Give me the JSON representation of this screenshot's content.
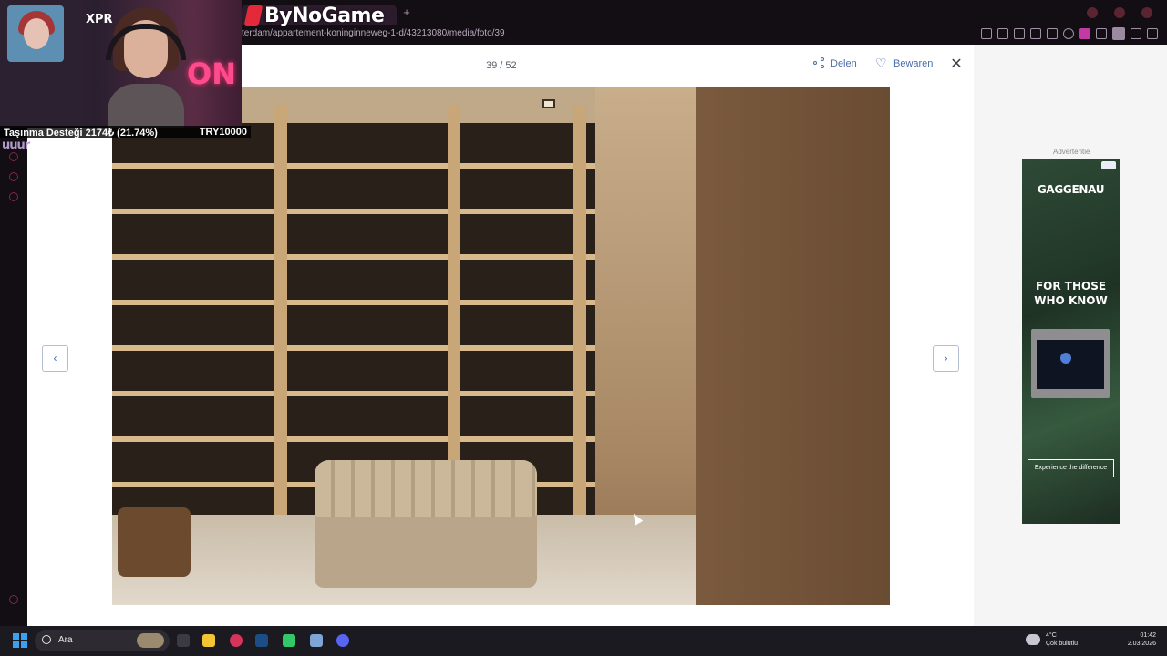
{
  "stream": {
    "brand": "ByNoGame",
    "cam_logo": "XPR",
    "neon_sign": "ON",
    "donation_label": "Taşınma Desteği 2174₺ (21.74%)",
    "donation_goal": "TRY10000",
    "donation_progress": 0.2174,
    "channel_mark": "uuur"
  },
  "browser": {
    "url": "terdam/appartement-koninginneweg-1-d/43213080/media/foto/39",
    "tab_icon": "plus-icon"
  },
  "viewer": {
    "counter": "39 / 52",
    "share_label": "Delen",
    "save_label": "Bewaren",
    "close_icon": "close-icon",
    "prev_icon": "chevron-left-icon",
    "next_icon": "chevron-right-icon",
    "photo_subject": "walk-in closet with shoe shelves and ottoman"
  },
  "ad": {
    "label": "Advertentie",
    "brand": "GAGGENAU",
    "tagline_1": "FOR THOSE",
    "tagline_2": "WHO KNOW",
    "cta": "Experience the difference"
  },
  "taskbar": {
    "search_label": "Ara",
    "weather_temp": "4°C",
    "weather_desc": "Çok bulutlu",
    "time": "01:42",
    "date": "2.03.2026"
  },
  "colors": {
    "accent": "#4a6da8",
    "stream_pink": "#ff4b8d",
    "ad_green": "#2e4a36"
  }
}
